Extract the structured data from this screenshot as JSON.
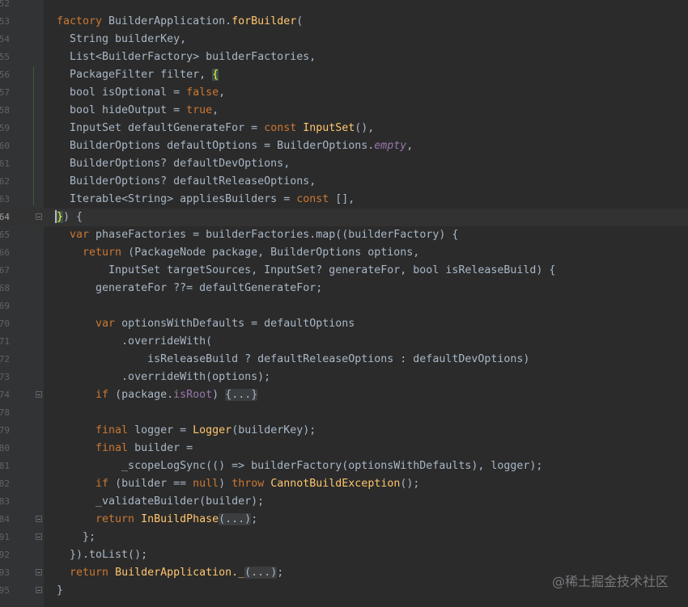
{
  "editor": {
    "lines": [
      {
        "num": "52",
        "tokens": []
      },
      {
        "num": "53",
        "tokens": [
          [
            "kw",
            "factory "
          ],
          [
            "plain",
            "BuilderApplication."
          ],
          [
            "fn",
            "forBuilder"
          ],
          [
            "plain",
            "("
          ]
        ]
      },
      {
        "num": "54",
        "tokens": [
          [
            "plain",
            "  String builderKey,"
          ]
        ]
      },
      {
        "num": "55",
        "tokens": [
          [
            "plain",
            "  List<BuilderFactory> builderFactories,"
          ]
        ]
      },
      {
        "num": "56",
        "tokens": [
          [
            "plain",
            "  PackageFilter filter, "
          ],
          [
            "hl",
            "{"
          ]
        ]
      },
      {
        "num": "57",
        "tokens": [
          [
            "plain",
            "  bool isOptional = "
          ],
          [
            "kw",
            "false"
          ],
          [
            "plain",
            ","
          ]
        ]
      },
      {
        "num": "58",
        "tokens": [
          [
            "plain",
            "  bool hideOutput = "
          ],
          [
            "kw",
            "true"
          ],
          [
            "plain",
            ","
          ]
        ]
      },
      {
        "num": "59",
        "tokens": [
          [
            "plain",
            "  InputSet defaultGenerateFor = "
          ],
          [
            "kw",
            "const "
          ],
          [
            "fn",
            "InputSet"
          ],
          [
            "plain",
            "(),"
          ]
        ]
      },
      {
        "num": "60",
        "tokens": [
          [
            "plain",
            "  BuilderOptions defaultOptions = BuilderOptions."
          ],
          [
            "it",
            "empty"
          ],
          [
            "plain",
            ","
          ]
        ]
      },
      {
        "num": "61",
        "tokens": [
          [
            "plain",
            "  BuilderOptions? defaultDevOptions,"
          ]
        ]
      },
      {
        "num": "62",
        "tokens": [
          [
            "plain",
            "  BuilderOptions? defaultReleaseOptions,"
          ]
        ]
      },
      {
        "num": "63",
        "tokens": [
          [
            "plain",
            "  Iterable<String> appliesBuilders = "
          ],
          [
            "kw",
            "const "
          ],
          [
            "plain",
            "[],"
          ]
        ]
      },
      {
        "num": "64",
        "tokens": [
          [
            "hl",
            "}"
          ],
          [
            "plain",
            ") {"
          ]
        ]
      },
      {
        "num": "65",
        "tokens": [
          [
            "kw",
            "  var "
          ],
          [
            "plain",
            "phaseFactories = builderFactories.map((builderFactory) {"
          ]
        ]
      },
      {
        "num": "66",
        "tokens": [
          [
            "kw",
            "    return "
          ],
          [
            "plain",
            "(PackageNode package, BuilderOptions options,"
          ]
        ]
      },
      {
        "num": "67",
        "tokens": [
          [
            "plain",
            "        InputSet targetSources, InputSet? generateFor, bool isReleaseBuild) {"
          ]
        ]
      },
      {
        "num": "68",
        "tokens": [
          [
            "plain",
            "      generateFor ??= defaultGenerateFor;"
          ]
        ]
      },
      {
        "num": "69",
        "tokens": []
      },
      {
        "num": "70",
        "tokens": [
          [
            "kw",
            "      var "
          ],
          [
            "plain",
            "optionsWithDefaults = defaultOptions"
          ]
        ]
      },
      {
        "num": "71",
        "tokens": [
          [
            "plain",
            "          .overrideWith("
          ]
        ]
      },
      {
        "num": "72",
        "tokens": [
          [
            "plain",
            "              isReleaseBuild ? defaultReleaseOptions : defaultDevOptions)"
          ]
        ]
      },
      {
        "num": "73",
        "tokens": [
          [
            "plain",
            "          .overrideWith(options);"
          ]
        ]
      },
      {
        "num": "74",
        "tokens": [
          [
            "kw",
            "      if "
          ],
          [
            "plain",
            "(package."
          ],
          [
            "fd",
            "isRoot"
          ],
          [
            "plain",
            ") "
          ],
          [
            "fold",
            "{...}"
          ]
        ]
      },
      {
        "num": "78",
        "tokens": []
      },
      {
        "num": "79",
        "tokens": [
          [
            "kw",
            "      final "
          ],
          [
            "plain",
            "logger = "
          ],
          [
            "fn",
            "Logger"
          ],
          [
            "plain",
            "(builderKey);"
          ]
        ]
      },
      {
        "num": "80",
        "tokens": [
          [
            "kw",
            "      final "
          ],
          [
            "plain",
            "builder ="
          ]
        ]
      },
      {
        "num": "81",
        "tokens": [
          [
            "plain",
            "          _scopeLogSync(() => builderFactory(optionsWithDefaults), logger);"
          ]
        ]
      },
      {
        "num": "82",
        "tokens": [
          [
            "kw",
            "      if "
          ],
          [
            "plain",
            "(builder == "
          ],
          [
            "kw",
            "null"
          ],
          [
            "plain",
            ") "
          ],
          [
            "kw",
            "throw "
          ],
          [
            "fn",
            "CannotBuildException"
          ],
          [
            "plain",
            "();"
          ]
        ]
      },
      {
        "num": "83",
        "tokens": [
          [
            "plain",
            "      _validateBuilder(builder);"
          ]
        ]
      },
      {
        "num": "84",
        "tokens": [
          [
            "kw",
            "      return "
          ],
          [
            "fn",
            "InBuildPhase"
          ],
          [
            "fold",
            "(...)"
          ],
          [
            "plain",
            ";"
          ]
        ]
      },
      {
        "num": "91",
        "tokens": [
          [
            "plain",
            "    };"
          ]
        ]
      },
      {
        "num": "92",
        "tokens": [
          [
            "plain",
            "  }).toList();"
          ]
        ]
      },
      {
        "num": "93",
        "tokens": [
          [
            "kw",
            "  return "
          ],
          [
            "fn",
            "BuilderApplication._"
          ],
          [
            "fold",
            "(...)"
          ],
          [
            "plain",
            ";"
          ]
        ]
      },
      {
        "num": "95",
        "tokens": [
          [
            "plain",
            "}"
          ]
        ]
      }
    ],
    "current_line": "64",
    "fold_markers": [
      "64",
      "74",
      "84",
      "91",
      "93",
      "95"
    ]
  },
  "watermark": "@稀土掘金技术社区",
  "colors": {
    "background": "#2b2b2b",
    "gutter": "#313335",
    "keyword": "#cc7832",
    "function": "#ffc66d",
    "field": "#9876aa",
    "text": "#a9b7c6"
  }
}
